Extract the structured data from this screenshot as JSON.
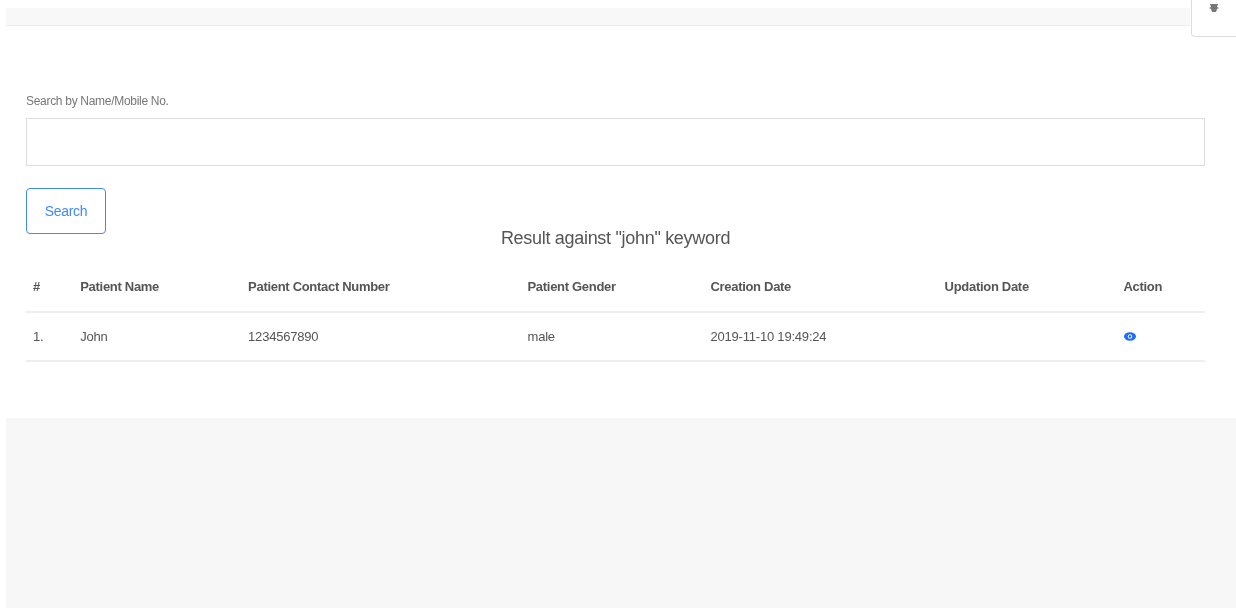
{
  "search": {
    "label": "Search by Name/Mobile No.",
    "button": "Search"
  },
  "result_title": "Result against \"john\" keyword",
  "table": {
    "columns": [
      "#",
      "Patient Name",
      "Patient Contact Number",
      "Patient Gender",
      "Creation Date",
      "Updation Date",
      "Action"
    ],
    "rows": [
      {
        "cells": [
          "1.",
          "John",
          "1234567890",
          "male",
          "2019-11-10 19:49:24"
        ],
        "action": {
          "kind": "view"
        }
      }
    ]
  }
}
